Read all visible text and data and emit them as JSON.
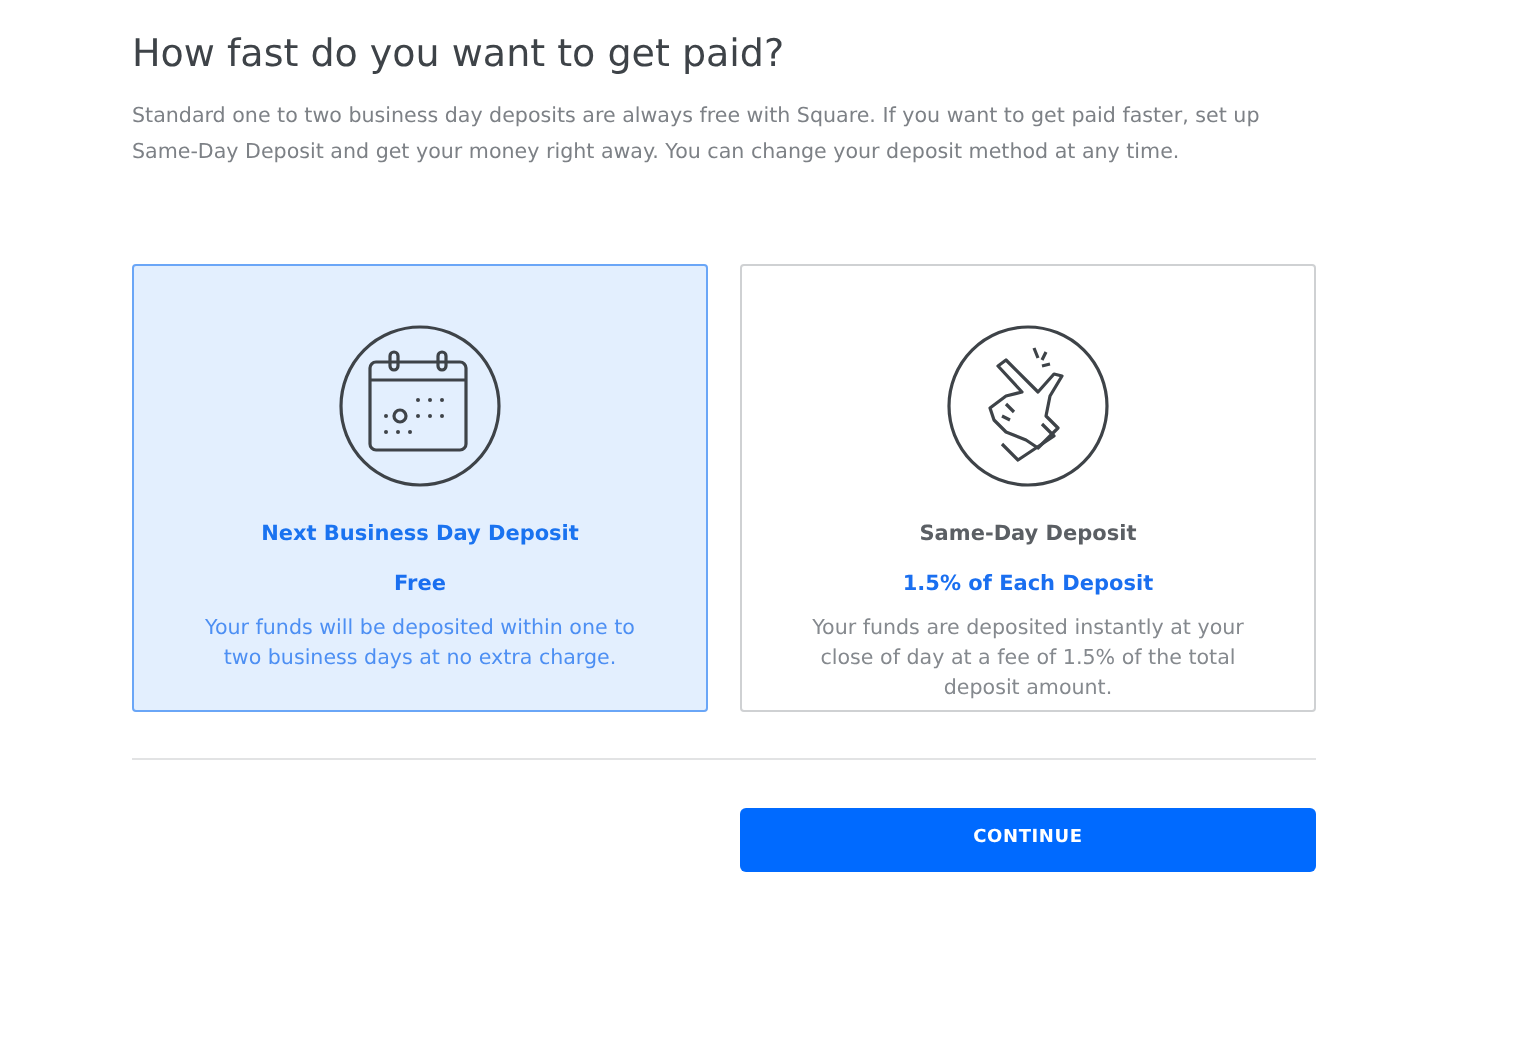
{
  "title": "How fast do you want to get paid?",
  "intro": "Standard one to two business day deposits are always free with Square. If you want to get paid faster, set up Same-Day Deposit and get your money right away. You can change your deposit method at any time.",
  "options": [
    {
      "kind": "calendar",
      "name": "Next Business Day Deposit",
      "price": "Free",
      "description": "Your funds will be deposited within one to two business days at no extra charge.",
      "selected": true
    },
    {
      "kind": "snap",
      "name": "Same-Day Deposit",
      "price": "1.5% of Each Deposit",
      "description": "Your funds are deposited instantly at your close of day at a fee of 1.5% of the total deposit amount.",
      "selected": false
    }
  ],
  "button": "CONTINUE"
}
